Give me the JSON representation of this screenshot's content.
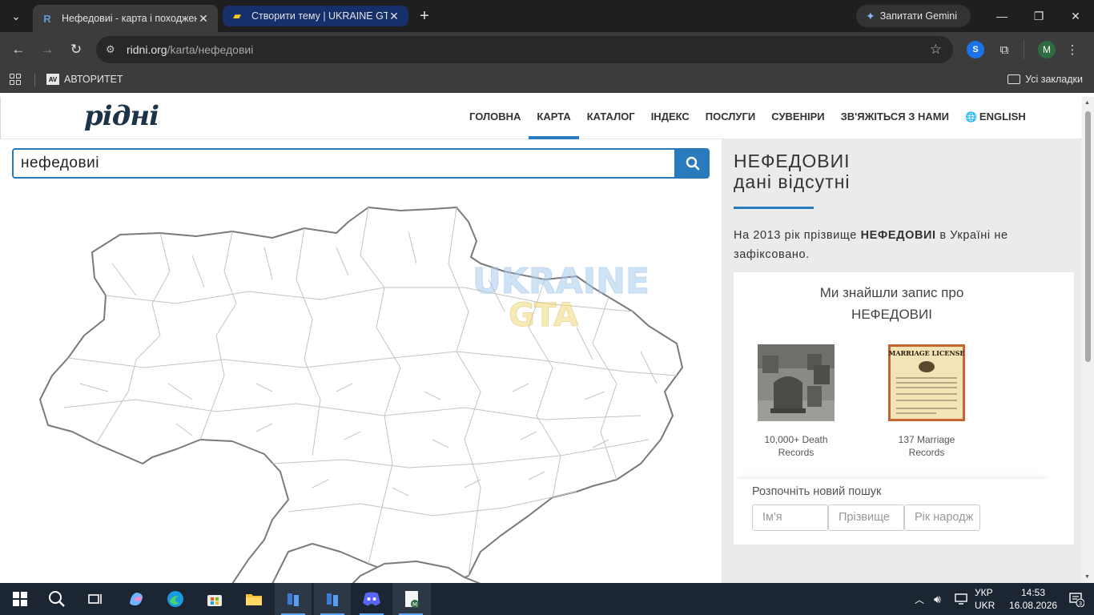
{
  "browser": {
    "tabs": [
      {
        "title": "Нефедовиі - карта і походжен",
        "active": true
      },
      {
        "title": "Створити тему | UKRAINE GTA",
        "active": false
      }
    ],
    "gemini_label": "Запитати Gemini",
    "url_host": "ridni.org",
    "url_path": "/karta/нефедовиі",
    "profile_initial": "M",
    "bookmark": "АВТОРИТЕТ",
    "all_bookmarks": "Усі закладки"
  },
  "site": {
    "logo": "рідні",
    "nav": [
      "ГОЛОВНА",
      "КАРТА",
      "КАТАЛОГ",
      "ІНДЕКС",
      "ПОСЛУГИ",
      "СУВЕНІРИ",
      "ЗВ'ЯЖІТЬСЯ З НАМИ",
      "ENGLISH"
    ],
    "active_nav": "КАРТА",
    "search_value": "нефедовиі",
    "watermark_line1": "UKRAINE",
    "watermark_line2": "GTA"
  },
  "panel": {
    "surname": "НЕФЕДОВИІ",
    "status": "дані відсутні",
    "sentence_pre": "На 2013 рік прізвище ",
    "sentence_name": "НЕФЕДОВИІ",
    "sentence_post": " в Україні не зафіксовано.",
    "card_title_line1": "Ми знайшли запис про",
    "card_title_line2": "НЕФЕДОВИІ",
    "records": [
      {
        "caption_line1": "10,000+ Death",
        "caption_line2": "Records"
      },
      {
        "caption_line1": "137 Marriage",
        "caption_line2": "Records"
      }
    ],
    "marriage_header": "MARRIAGE LICENSE",
    "new_search_label": "Розпочніть новий пошук",
    "fields": [
      {
        "placeholder": "Ім'я"
      },
      {
        "placeholder": "Прізвище"
      },
      {
        "placeholder": "Рік народж"
      }
    ]
  },
  "taskbar": {
    "lang_line1": "УКР",
    "lang_line2": "UKR",
    "time": "14:53",
    "date": "16.08.2026",
    "notifications": "3"
  },
  "colors": {
    "accent": "#2a7bbd",
    "panel_bg": "#ebebeb",
    "chrome_dark": "#1f1f1f",
    "taskbar": "#1c2532"
  }
}
